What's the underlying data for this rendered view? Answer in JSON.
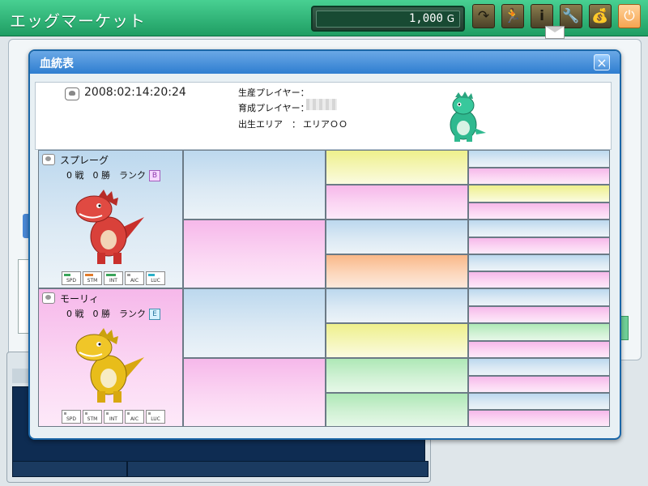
{
  "app": {
    "title": "エッグマーケット",
    "money": "1,000",
    "money_unit": "G"
  },
  "toolbar": {
    "buttons": [
      {
        "name": "return-button",
        "icon": "u-turn-arrow-icon",
        "glyph": "↷"
      },
      {
        "name": "run-button",
        "icon": "running-man-icon",
        "glyph": "🏃"
      },
      {
        "name": "info-button",
        "icon": "info-icon",
        "glyph": "i"
      },
      {
        "name": "tool-button",
        "icon": "wrench-icon",
        "glyph": "🔧"
      },
      {
        "name": "bag-button",
        "icon": "money-bag-icon",
        "glyph": "💰"
      },
      {
        "name": "power-button",
        "icon": "power-icon",
        "glyph": "⏻"
      }
    ]
  },
  "dialog": {
    "title": "血統表",
    "close_icon": "×",
    "info": {
      "date": "2008:02:14:20:24",
      "producer_label": "生産プレイヤー：",
      "producer_value": "",
      "breeder_label": "育成プレイヤー：",
      "area_label": "出生エリア　：",
      "area_value": "エリアＯＯ"
    },
    "father": {
      "name": "スプレーグ",
      "stats": "0 戦　0 勝",
      "rank_label": "ランク",
      "rank": "B",
      "stat_labels": [
        "SPD",
        "STM",
        "INT",
        "AIC",
        "LUC"
      ]
    },
    "mother": {
      "name": "モーリィ",
      "stats": "0 戦　0 勝",
      "rank_label": "ランク",
      "rank": "E",
      "stat_labels": [
        "SPD",
        "STM",
        "INT",
        "AIC",
        "LUC"
      ]
    },
    "tree_colors": {
      "blue": "#bcd8ee",
      "pink": "#f6b8ea",
      "yellow": "#eef08c",
      "orange": "#f9b889",
      "green": "#aee8b6"
    }
  }
}
